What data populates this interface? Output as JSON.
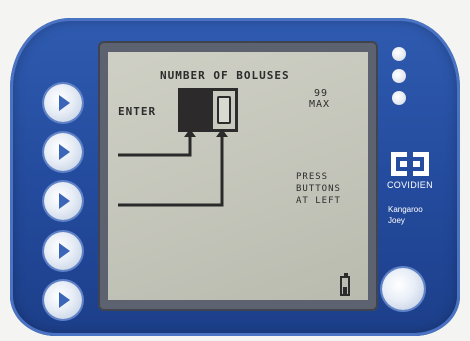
{
  "device": {
    "brand": "COVIDIEN",
    "product_line1": "Kangaroo",
    "product_line2": "Joey",
    "accent_color": "#2f5bb0"
  },
  "screen": {
    "title": "NUMBER OF BOLUSES",
    "enter_label": "ENTER",
    "digit_left": "",
    "digit_right": "0",
    "max_value": "99",
    "max_label": "MAX",
    "instruction_line1": "PRESS",
    "instruction_line2": "BUTTONS",
    "instruction_line3": "AT LEFT",
    "battery_icon": "battery-icon"
  },
  "soft_buttons": [
    {
      "icon": "triangle-right-icon"
    },
    {
      "icon": "triangle-right-icon"
    },
    {
      "icon": "triangle-right-icon"
    },
    {
      "icon": "triangle-right-icon"
    },
    {
      "icon": "triangle-right-icon"
    }
  ],
  "power_button": {
    "icon": "power-button-icon"
  }
}
